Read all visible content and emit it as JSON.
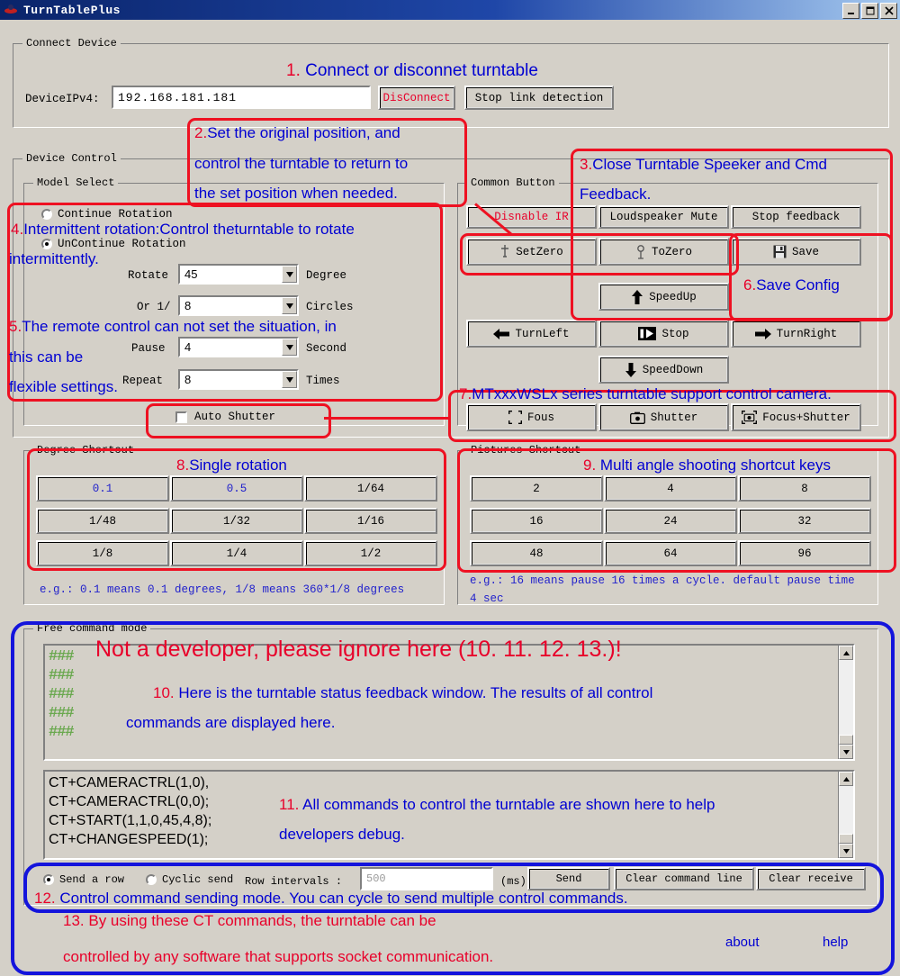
{
  "window": {
    "title": "TurnTablePlus",
    "buttons": {
      "minimize": "_",
      "maximize": "□",
      "close": "×"
    }
  },
  "connect_device": {
    "legend": "Connect Device",
    "ip_label": "DeviceIPv4:",
    "ip_value": "192.168.181.181",
    "disconnect_button": "DisConnect",
    "stop_link_button": "Stop link detection"
  },
  "device_control": {
    "legend": "Device Control",
    "model_select": {
      "legend": "Model Select",
      "radio_continue": "Continue Rotation",
      "radio_uncontinue": "UnContinue Rotation",
      "selected": "UnContinue Rotation",
      "rotate_label": "Rotate",
      "rotate_value": "45",
      "rotate_unit": "Degree",
      "circles_label": "Or 1/",
      "circles_value": "8",
      "circles_unit": "Circles",
      "pause_label": "Pause",
      "pause_value": "4",
      "pause_unit": "Second",
      "repeat_label": "Repeat",
      "repeat_value": "8",
      "repeat_unit": "Times",
      "auto_shutter": "Auto Shutter",
      "auto_shutter_checked": false
    },
    "common_button": {
      "legend": "Common Button",
      "disable_ir": "Disnable IR",
      "loudspeaker_mute": "Loudspeaker Mute",
      "stop_feedback": "Stop feedback",
      "set_zero": "SetZero",
      "to_zero": "ToZero",
      "save": "Save",
      "speed_up": "SpeedUp",
      "turn_left": "TurnLeft",
      "stop": "Stop",
      "turn_right": "TurnRight",
      "speed_down": "SpeedDown",
      "focus": "Fous",
      "shutter": "Shutter",
      "focus_shutter": "Focus+Shutter"
    }
  },
  "degree_shortcut": {
    "legend": "Degree Shortcut",
    "buttons": [
      "0.1",
      "0.5",
      "1/64",
      "1/48",
      "1/32",
      "1/16",
      "1/8",
      "1/4",
      "1/2"
    ],
    "note": "e.g.: 0.1 means 0.1 degrees, 1/8 means 360*1/8 degrees"
  },
  "pictures_shortcut": {
    "legend": "Pictures Shortcut",
    "buttons": [
      "2",
      "4",
      "8",
      "16",
      "24",
      "32",
      "48",
      "64",
      "96"
    ],
    "note_line1": "e.g.: 16 means pause 16 times a cycle. default pause time",
    "note_line2": "4 sec"
  },
  "free_command_mode": {
    "legend": "Free command mode",
    "feedback_lines": [
      "###",
      "###",
      "###",
      "###",
      "###"
    ],
    "command_lines": [
      "CT+CAMERACTRL(1,0),",
      "CT+CAMERACTRL(0,0);",
      "CT+START(1,1,0,45,4,8);",
      "CT+CHANGESPEED(1);"
    ],
    "send_a_row": "Send a row",
    "cyclic_send": "Cyclic send",
    "send_mode_selected": "Send a row",
    "row_intervals_label": "Row intervals :",
    "row_intervals_placeholder": "500",
    "ms_unit": "(ms)",
    "send_button": "Send",
    "clear_command_line_button": "Clear command line",
    "clear_receive_button": "Clear receive"
  },
  "footer": {
    "about": "about",
    "help": "help"
  },
  "annotations": {
    "a1": {
      "num": "1.",
      "text": "Connect or disconnet turntable"
    },
    "a2": {
      "num": "2.",
      "l1": "Set the original position, and",
      "l2": "control the turntable to return to",
      "l3": "the set position when needed."
    },
    "a3": {
      "num": "3.",
      "l1": "Close Turntable Speeker and Cmd",
      "l2": "Feedback."
    },
    "a4": {
      "num": "4.",
      "l1": "Intermittent rotation:Control theturntable to rotate",
      "l2": "intermittently."
    },
    "a5": {
      "num": "5.",
      "l1": "The remote control can not set the situation, in",
      "l2": "this can be",
      "l3": "flexible settings."
    },
    "a6": {
      "num": "6.",
      "text": "Save  Config"
    },
    "a7": {
      "num": "7.",
      "text": "MTxxxWSLx series turntable support control camera."
    },
    "a8": {
      "num": "8.",
      "text": "Single  rotation"
    },
    "a9": {
      "num": "9.",
      "text": "Multi angle shooting shortcut keys"
    },
    "a_warn": {
      "text": "Not a developer, please ignore here (10. 11. 12. 13.)!"
    },
    "a10": {
      "num": "10.",
      "l1": "Here is the turntable status feedback window. The results of all control",
      "l2": "commands are displayed here."
    },
    "a11": {
      "num": "11.",
      "l1": "All commands to control the turntable are shown here to help",
      "l2": "developers debug."
    },
    "a12": {
      "num": "12.",
      "text": "Control command sending mode. You can cycle to send multiple control commands."
    },
    "a13": {
      "num": "13.",
      "l1": "By using these CT commands, the turntable can be",
      "l2": "controlled by any software that supports socket communication."
    }
  },
  "colors": {
    "face": "#d4d0c8",
    "annotation_blue": "#0000d2",
    "annotation_red": "#e8002a",
    "outline_red": "#ee1122",
    "outline_blue": "#1414dc",
    "hint_blue": "#2222cc",
    "feedback_green": "#6aa84f",
    "titlebar_blue": "#0a246a"
  }
}
